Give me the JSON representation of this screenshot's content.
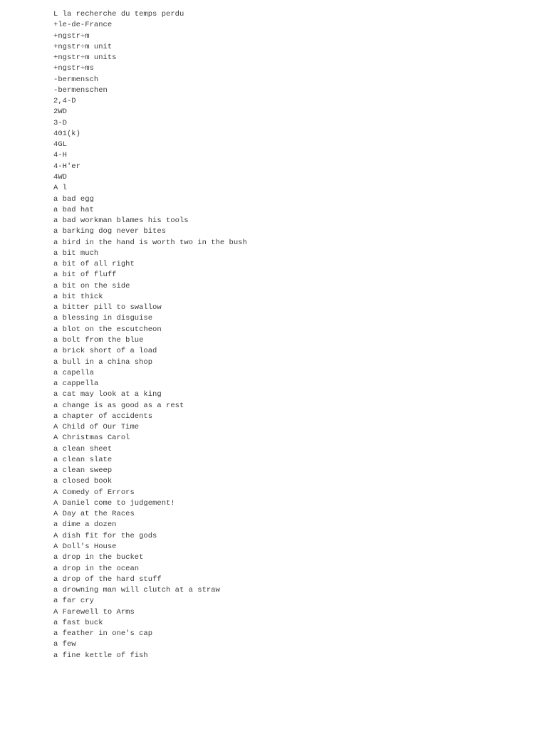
{
  "document": {
    "kind": "plain-text-word-list",
    "background_color": "#ffffff",
    "text_color": "#3a3a3a",
    "entries": [
      "L la recherche du temps perdu",
      "+le-de-France",
      "+ngstr÷m",
      "+ngstr÷m unit",
      "+ngstr÷m units",
      "+ngstr÷ms",
      "-bermensch",
      "-bermenschen",
      "2,4-D",
      "2WD",
      "3-D",
      "401(k)",
      "4GL",
      "4-H",
      "4-H'er",
      "4WD",
      "A l",
      "a bad egg",
      "a bad hat",
      "a bad workman blames his tools",
      "a barking dog never bites",
      "a bird in the hand is worth two in the bush",
      "a bit much",
      "a bit of all right",
      "a bit of fluff",
      "a bit on the side",
      "a bit thick",
      "a bitter pill to swallow",
      "a blessing in disguise",
      "a blot on the escutcheon",
      "a bolt from the blue",
      "a brick short of a load",
      "a bull in a china shop",
      "a capella",
      "a cappella",
      "a cat may look at a king",
      "a change is as good as a rest",
      "a chapter of accidents",
      "A Child of Our Time",
      "A Christmas Carol",
      "a clean sheet",
      "a clean slate",
      "a clean sweep",
      "a closed book",
      "A Comedy of Errors",
      "A Daniel come to judgement!",
      "A Day at the Races",
      "a dime a dozen",
      "A dish fit for the gods",
      "A Doll's House",
      "a drop in the bucket",
      "a drop in the ocean",
      "a drop of the hard stuff",
      "a drowning man will clutch at a straw",
      "a far cry",
      "A Farewell to Arms",
      "a fast buck",
      "a feather in one's cap",
      "a few",
      "a fine kettle of fish"
    ]
  }
}
